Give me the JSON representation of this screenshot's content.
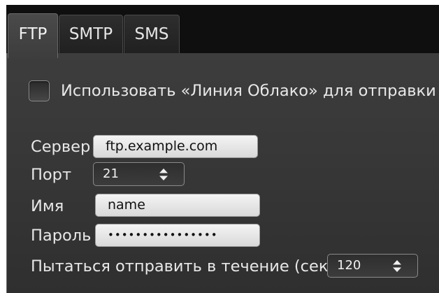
{
  "tabs": [
    {
      "label": "FTP",
      "active": true
    },
    {
      "label": "SMTP",
      "active": false
    },
    {
      "label": "SMS",
      "active": false
    }
  ],
  "cloud_checkbox": {
    "label": "Использовать «Линия Облако» для отправки",
    "checked": false
  },
  "form": {
    "server_label": "Сервер",
    "server_value": "ftp.example.com",
    "port_label": "Порт",
    "port_value": "21",
    "name_label": "Имя",
    "name_value": "name",
    "password_label": "Пароль",
    "password_value": "••••••••••••••••",
    "retry_label": "Пытаться отправить в течение (сек.)",
    "retry_value": "120"
  },
  "icons": {
    "spin_arrows": "updown-arrows-icon"
  },
  "colors": {
    "panel_bg": "#3a3a3a",
    "tabbar_bg": "#0f0f0f",
    "text": "#e8e8e8",
    "field_bg": "#e6e6e6"
  }
}
